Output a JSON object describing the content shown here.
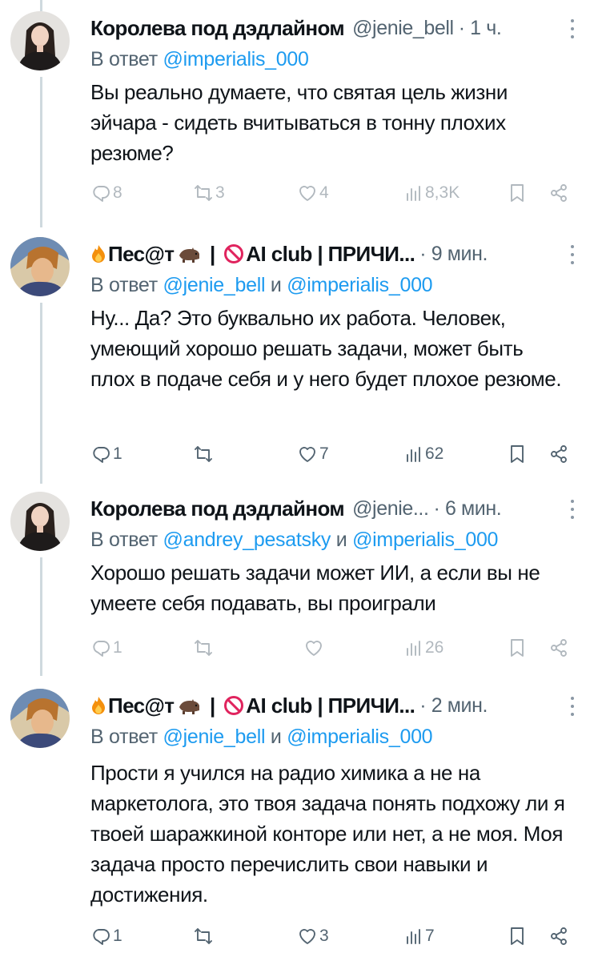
{
  "tweets": [
    {
      "name": "Королева под дэдлайном",
      "handle": "@jenie_bell",
      "time": "· 1 ч.",
      "reply_prefix": "В ответ",
      "mentions": [
        "@imperialis_000"
      ],
      "reply_joiner": "",
      "text": "Вы реально думаете, что святая цель жизни эйчара - сидеть вчитываться в тонну плохих резюме?",
      "replies": "8",
      "reposts": "3",
      "likes": "4",
      "views": "8,3K"
    },
    {
      "name_prefix": "Пес@т",
      "name_middle": " | ",
      "name_suffix": "AI club | ПРИЧИ...",
      "time": "· 9 мин.",
      "reply_prefix": "В ответ",
      "mentions": [
        "@jenie_bell",
        "@imperialis_000"
      ],
      "reply_joiner": "и",
      "text": "Ну... Да? Это буквально их работа. Человек, умеющий хорошо решать задачи, может быть плох в подаче себя и у него будет плохое резюме.",
      "replies": "1",
      "reposts": "",
      "likes": "7",
      "views": "62"
    },
    {
      "name": "Королева под дэдлайном",
      "handle": "@jenie...",
      "time": "· 6 мин.",
      "reply_prefix": "В ответ",
      "mentions": [
        "@andrey_pesatsky",
        "@imperialis_000"
      ],
      "reply_joiner": "и",
      "text": "Хорошо решать задачи может ИИ, а если вы не умеете себя подавать, вы проиграли",
      "replies": "1",
      "reposts": "",
      "likes": "",
      "views": "26"
    },
    {
      "name_prefix": "Пес@т",
      "name_middle": " | ",
      "name_suffix": "AI club | ПРИЧИ...",
      "time": "· 2 мин.",
      "reply_prefix": "В ответ",
      "mentions": [
        "@jenie_bell",
        "@imperialis_000"
      ],
      "reply_joiner": "и",
      "text": "Прости я учился на радио химика а не на маркетолога, это твоя задача понять подхожу ли я твоей шаражкиной конторе или нет, а не моя. Моя задача просто перечислить свои навыки и достижения.",
      "replies": "1",
      "reposts": "",
      "likes": "3",
      "views": "7"
    }
  ],
  "icons": {
    "reply": "reply-icon",
    "repost": "repost-icon",
    "like": "like-icon",
    "views": "views-icon",
    "bookmark": "bookmark-icon",
    "share": "share-icon",
    "more": "more-icon"
  },
  "colors": {
    "text": "#0f1419",
    "secondary": "#536471",
    "link": "#1d9bf0",
    "thread_line": "#cfd9de"
  }
}
